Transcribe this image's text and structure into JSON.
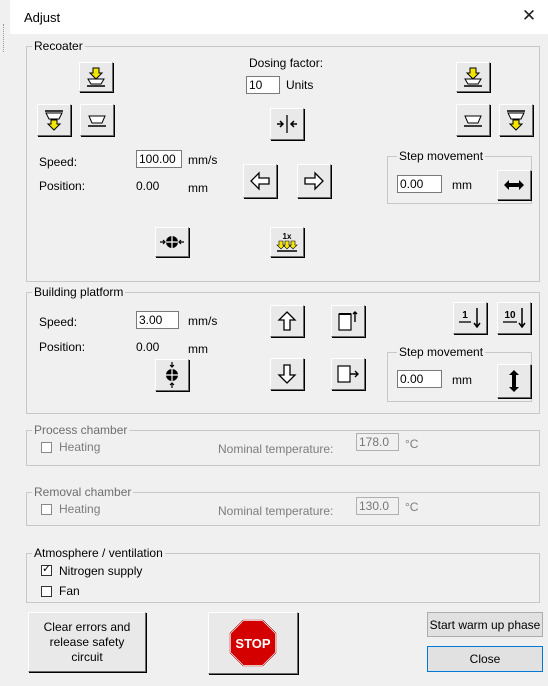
{
  "window": {
    "title": "Adjust"
  },
  "recoater": {
    "group_label": "Recoater",
    "dosing_factor_label": "Dosing factor:",
    "dosing_factor_value": "10",
    "dosing_units": "Units",
    "speed_label": "Speed:",
    "speed_value": "100.00",
    "speed_unit": "mm/s",
    "position_label": "Position:",
    "position_value": "0.00",
    "position_unit": "mm",
    "step_label": "Step movement",
    "step_value": "0.00",
    "step_unit": "mm",
    "multiplier_badge": "1x"
  },
  "platform": {
    "group_label": "Building platform",
    "speed_label": "Speed:",
    "speed_value": "3.00",
    "speed_unit": "mm/s",
    "position_label": "Position:",
    "position_value": "0.00",
    "position_unit": "mm",
    "step_label": "Step movement",
    "step_value": "0.00",
    "step_unit": "mm",
    "step1_label": "1",
    "step10_label": "10"
  },
  "process_chamber": {
    "group_label": "Process chamber",
    "heating_label": "Heating",
    "heating_checked": false,
    "nominal_label": "Nominal temperature:",
    "nominal_value": "178.0",
    "unit": "°C"
  },
  "removal_chamber": {
    "group_label": "Removal chamber",
    "heating_label": "Heating",
    "heating_checked": false,
    "nominal_label": "Nominal temperature:",
    "nominal_value": "130.0",
    "unit": "°C"
  },
  "atmosphere": {
    "group_label": "Atmosphere / ventilation",
    "nitrogen_label": "Nitrogen supply",
    "nitrogen_checked": true,
    "fan_label": "Fan",
    "fan_checked": false
  },
  "buttons": {
    "clear_errors": "Clear errors and release safety circuit",
    "stop": "STOP",
    "start_warmup": "Start warm up phase",
    "close": "Close"
  },
  "colors": {
    "arrow_yellow": "#f5e600",
    "stop_red": "#d40000",
    "dialog_bg": "#f0f0f0"
  }
}
